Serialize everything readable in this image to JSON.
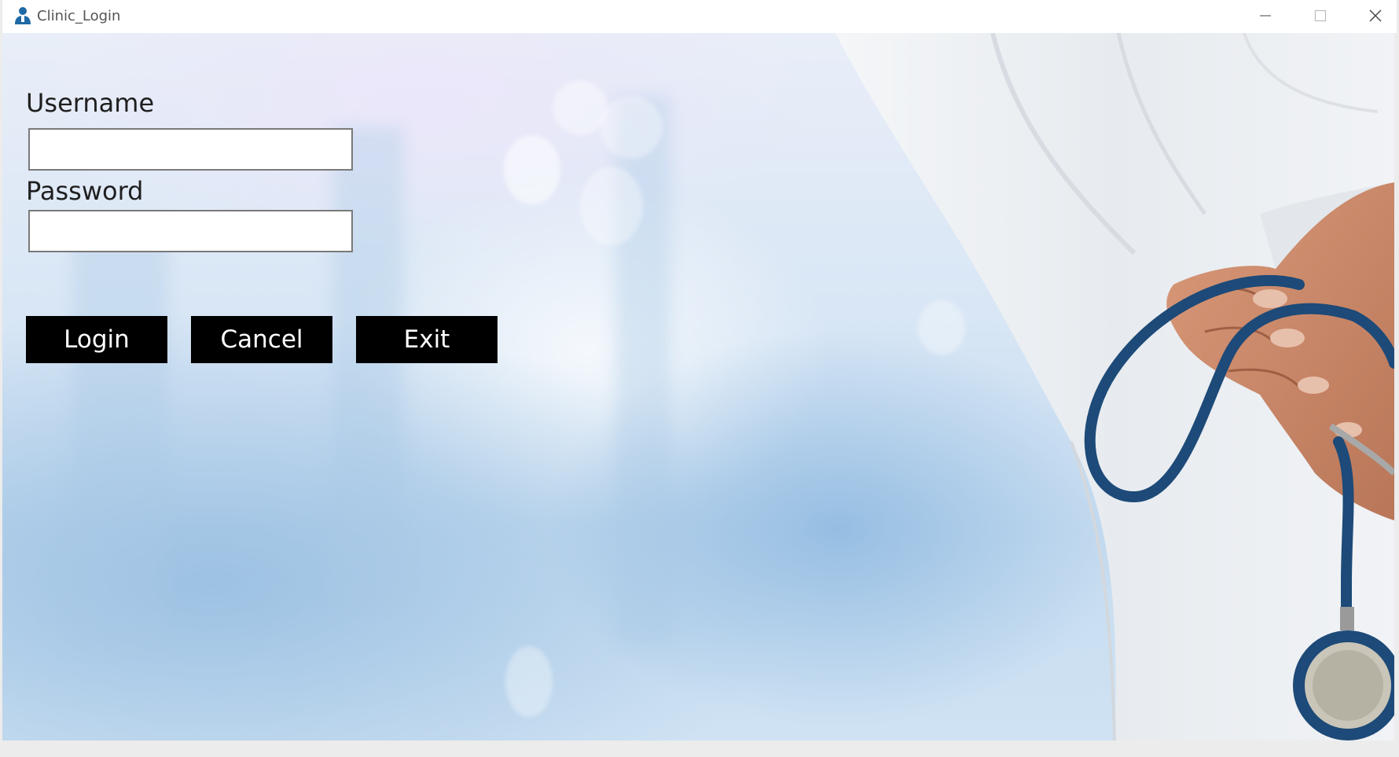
{
  "window": {
    "title": "Clinic_Login",
    "controls": [
      "minimize-icon",
      "maximize-icon",
      "close-icon"
    ]
  },
  "form": {
    "username_label": "Username",
    "username_value": "",
    "password_label": "Password",
    "password_value": ""
  },
  "buttons": {
    "login": "Login",
    "cancel": "Cancel",
    "exit": "Exit"
  },
  "colors": {
    "button_bg": "#000000",
    "button_text": "#ffffff",
    "icon_accent": "#1f6aa5"
  }
}
